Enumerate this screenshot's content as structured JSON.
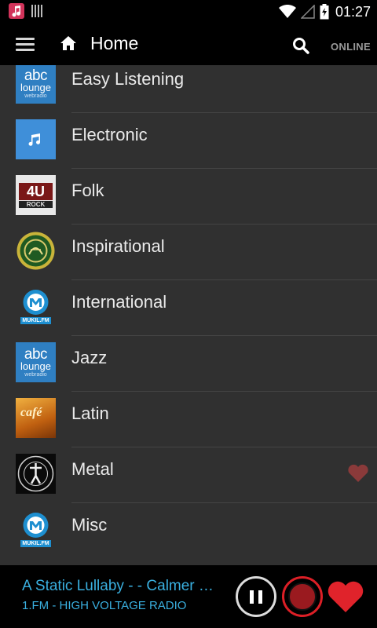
{
  "status_bar": {
    "time": "01:27"
  },
  "app_bar": {
    "title": "Home",
    "status": "ONLINE"
  },
  "colors": {
    "accent": "#3ab0e0",
    "record": "#dc1f26",
    "favorite": "#e0232b",
    "favorite_dim": "#8a3a3a"
  },
  "genres": [
    {
      "label": "Easy Listening",
      "thumb": "abc-lounge",
      "favorite": false
    },
    {
      "label": "Electronic",
      "thumb": "music-note",
      "favorite": false
    },
    {
      "label": "Folk",
      "thumb": "4u-rock",
      "favorite": false
    },
    {
      "label": "Inspirational",
      "thumb": "emblem",
      "favorite": false
    },
    {
      "label": "International",
      "thumb": "mukil-fm",
      "favorite": false
    },
    {
      "label": "Jazz",
      "thumb": "abc-lounge",
      "favorite": false
    },
    {
      "label": "Latin",
      "thumb": "cafe",
      "favorite": false
    },
    {
      "label": "Metal",
      "thumb": "seal",
      "favorite": true
    },
    {
      "label": "Misc",
      "thumb": "mukil-fm",
      "favorite": false
    }
  ],
  "thumb_text": {
    "abc": "abc",
    "lounge": "lounge",
    "webradio": "webradio",
    "four_u": "4U",
    "rock": "ROCK",
    "mukil": "MUKIL.FM",
    "cafe": "café"
  },
  "player": {
    "song": "A Static Lullaby -  - Calmer …",
    "station": "1.FM - HIGH VOLTAGE RADIO"
  }
}
